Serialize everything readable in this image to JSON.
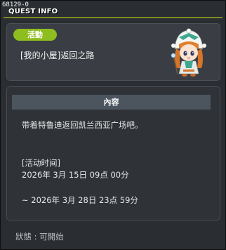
{
  "window": {
    "quest_id": "68129-0",
    "title": "QUEST INFO"
  },
  "quest": {
    "badge": "活動",
    "name": "[我的小屋]返回之路",
    "npc_icon": "npc-portrait-icon"
  },
  "content": {
    "header": "內容",
    "description": "带着特鲁迪返回凯兰西亚广场吧。",
    "event_label": "[活动时间]",
    "event_start": "2026年 3月 15日 09点 00分",
    "event_end": "~ 2026年 3月 28日 23点 59分"
  },
  "status": {
    "text": "狀態 : 可開始"
  },
  "colors": {
    "badge": "#8ebd1f",
    "title_line": "#7e8a22",
    "panel": "#3a3e44",
    "header": "#4c555e"
  }
}
